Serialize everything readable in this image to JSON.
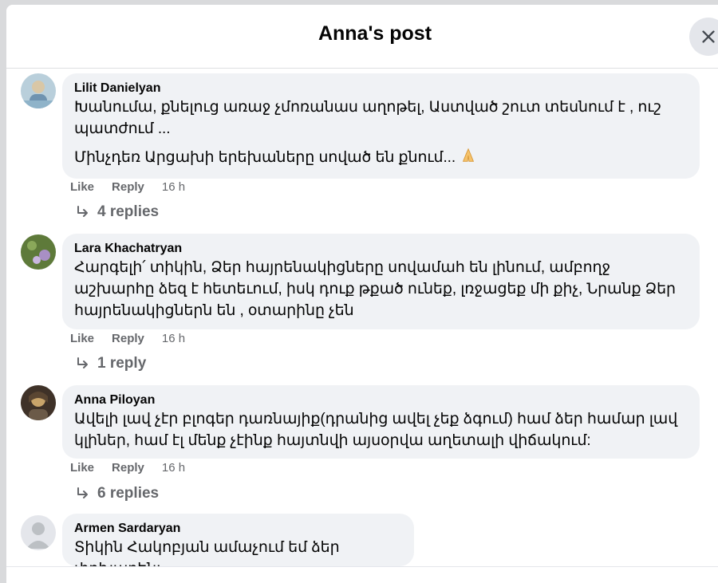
{
  "modal": {
    "title": "Anna's post",
    "close_icon": "close-icon"
  },
  "comments": [
    {
      "author": "Lilit Danielyan",
      "text": "Խանումա, քնելուց առաջ չմոռանաս աղոթել, Աստված շուտ տեսնում է , ուշ պատժում ...",
      "text2": "Մինչդեռ Արցախի երեխաները սոված են քնում...",
      "emoji_icon": "folded-hands-icon",
      "like": "Like",
      "reply": "Reply",
      "time": "16 h",
      "replies": "4 replies",
      "avatar_colors": [
        "#8fb3c9",
        "#d9c7a6"
      ]
    },
    {
      "author": "Lara Khachatryan",
      "text": "Հարգելի՛ տիկին, Ձեր հայրենակիցները սովամահ են լինում, ամբողջ աշխարհը ձեզ է հետեւում, իսկ դուք թքած ունեք, լռջացեք մի քիչ, Նրանք Ձեր հայրենակիցներն են , օտարինը չեն",
      "like": "Like",
      "reply": "Reply",
      "time": "16 h",
      "replies": "1 reply",
      "avatar_colors": [
        "#5e7a3a",
        "#a88fc4"
      ]
    },
    {
      "author": "Anna Piloyan",
      "text": "Ավելի լավ չէր բլոգեր դառնայիք(դրանից ավել չեք ձգում) համ ձեր համար լավ կլիներ, համ էլ մենք չէինք հայտնվի այսօրվա աղետալի վիճակում:",
      "like": "Like",
      "reply": "Reply",
      "time": "16 h",
      "replies": "6 replies",
      "avatar_colors": [
        "#5a4632",
        "#c8a46a"
      ]
    },
    {
      "author": "Armen Sardaryan",
      "text": "Տիկին Հակոբյան ամաչում եմ ձեր փոխարեն:",
      "avatar_colors": [
        "#c9ccd1",
        "#ffffff"
      ]
    }
  ],
  "icons": {
    "reply_arrow": "reply-arrow-icon"
  },
  "colors": {
    "bubble": "#f0f2f5",
    "secondary_text": "#65676b",
    "close_bg": "#e4e6eb"
  }
}
